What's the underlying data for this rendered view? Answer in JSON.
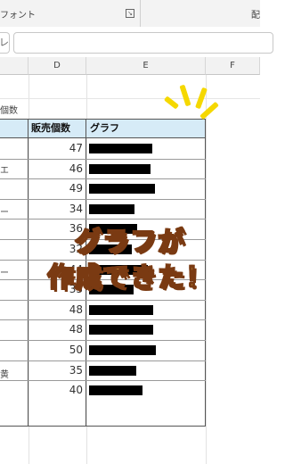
{
  "ribbon": {
    "group_label": "フォント",
    "launcher_glyph": "↘",
    "right_label": "配"
  },
  "formula_bar": {
    "name_box_fragment": "レ"
  },
  "columns": [
    "D",
    "E",
    "F"
  ],
  "side_label": "個数",
  "left_fragments": [
    "エ",
    "ー",
    "ー",
    "黄"
  ],
  "table": {
    "header_count": "販売個数",
    "header_graph": "グラフ",
    "values": [
      "47",
      "46",
      "49",
      "34",
      "36",
      "32",
      "44",
      "33",
      "48",
      "48",
      "50",
      "35",
      "40"
    ]
  },
  "chart_data": {
    "type": "bar",
    "values": [
      47,
      46,
      49,
      34,
      36,
      32,
      44,
      33,
      48,
      48,
      50,
      35,
      40
    ],
    "bar_color": "#000000",
    "header_color": "#d6ebf7"
  },
  "overlay": {
    "line1": "グラフが",
    "line2": "作成できた！"
  }
}
